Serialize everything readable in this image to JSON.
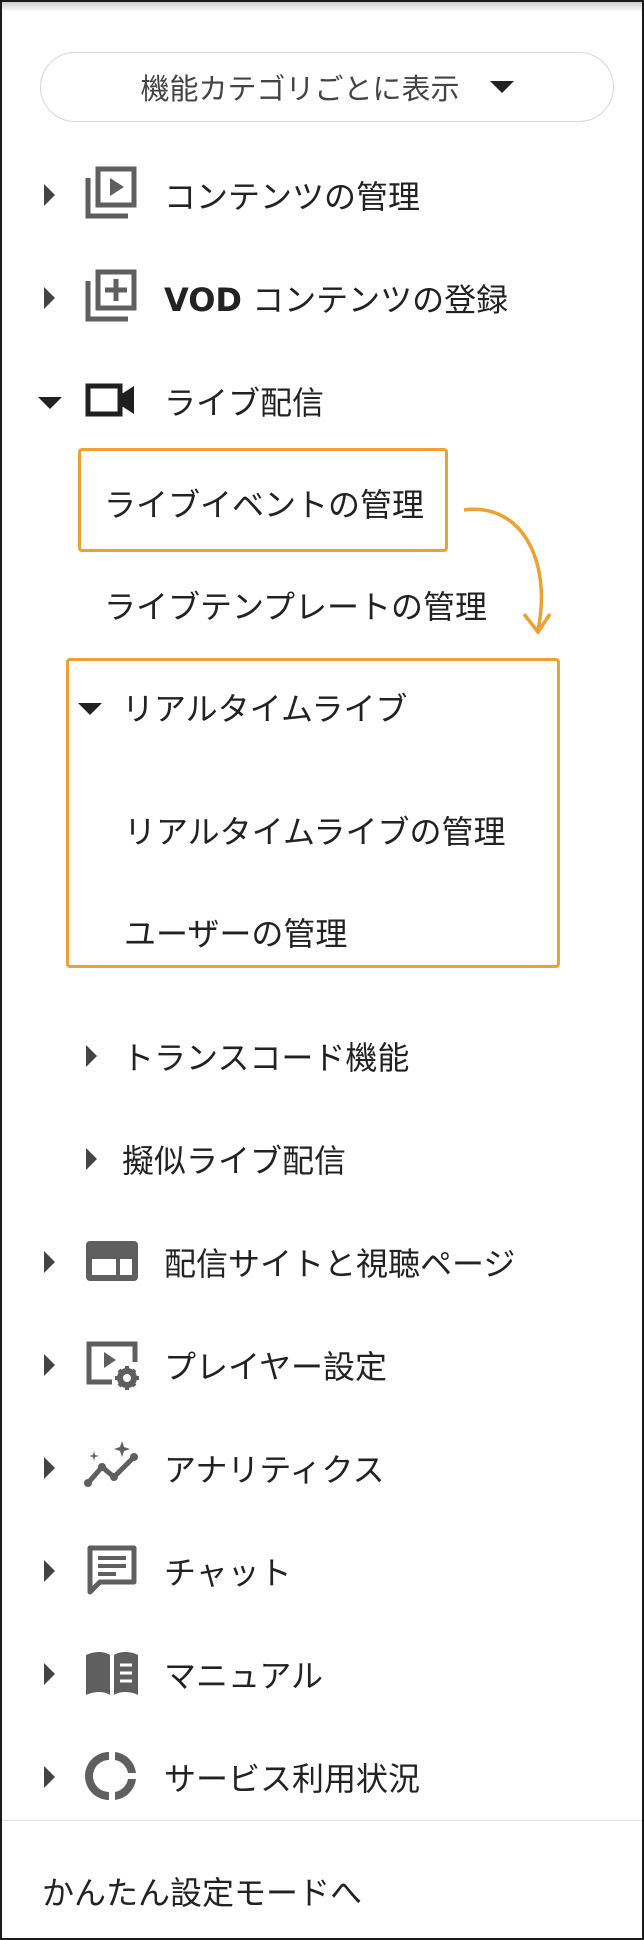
{
  "view_selector": {
    "label": "機能カテゴリごとに表示",
    "icon": "caret-down-icon"
  },
  "menu": {
    "contents": {
      "label": "コンテンツの管理",
      "icon": "video-library-icon"
    },
    "vod": {
      "bold_prefix": "VOD",
      "label": " コンテンツの登録",
      "icon": "add-to-library-icon"
    },
    "live": {
      "label": "ライブ配信",
      "icon": "videocam-icon",
      "children": {
        "live_event": "ライブイベントの管理",
        "live_template": "ライブテンプレートの管理",
        "realtime": {
          "label": "リアルタイムライブ",
          "children": {
            "realtime_manage": "リアルタイムライブの管理",
            "user_manage": "ユーザーの管理"
          }
        },
        "transcode": "トランスコード機能",
        "pseudo_live": "擬似ライブ配信"
      }
    },
    "site": {
      "label": "配信サイトと視聴ページ",
      "icon": "web-layout-icon"
    },
    "player": {
      "label": "プレイヤー設定",
      "icon": "player-settings-icon"
    },
    "analytics": {
      "label": "アナリティクス",
      "icon": "analytics-icon"
    },
    "chat": {
      "label": "チャット",
      "icon": "chat-icon"
    },
    "manual": {
      "label": "マニュアル",
      "icon": "manual-book-icon"
    },
    "usage": {
      "label": "サービス利用状況",
      "icon": "usage-donut-icon"
    }
  },
  "footer": {
    "easy_mode_link": "かんたん設定モードへ"
  },
  "colors": {
    "highlight": "#f0a030",
    "icon": "#5f5f5f",
    "text": "#222222"
  }
}
